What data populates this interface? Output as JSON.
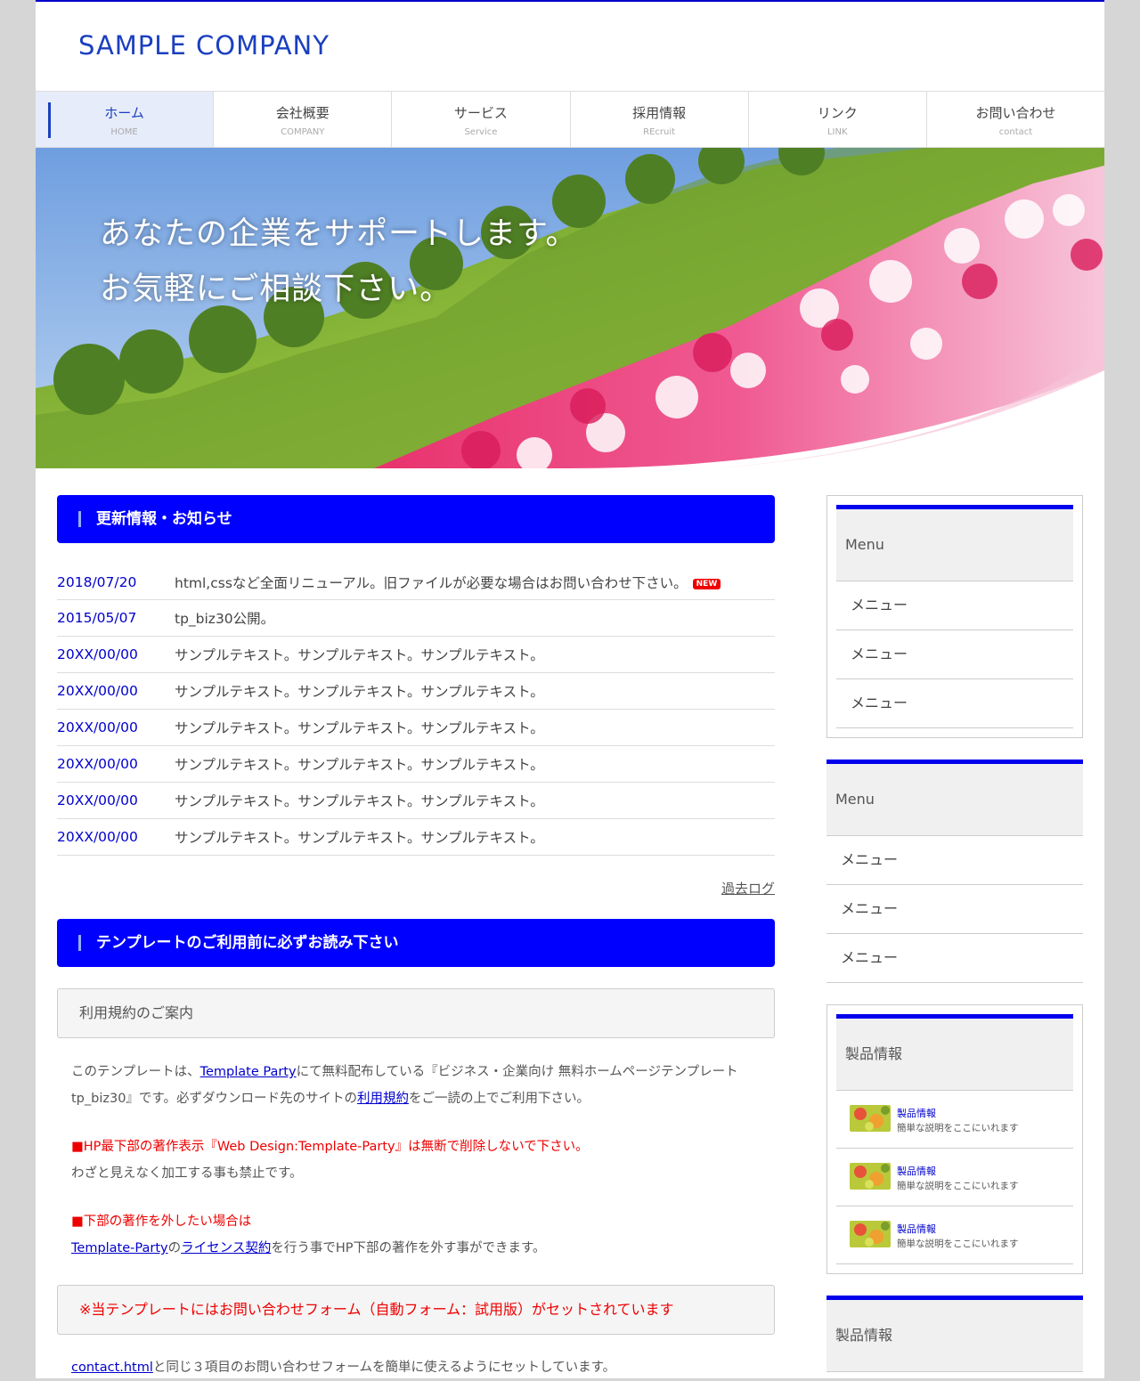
{
  "logo": "SAMPLE COMPANY",
  "nav": [
    {
      "ja": "ホーム",
      "en": "HOME"
    },
    {
      "ja": "会社概要",
      "en": "COMPANY"
    },
    {
      "ja": "サービス",
      "en": "Service"
    },
    {
      "ja": "採用情報",
      "en": "REcruit"
    },
    {
      "ja": "リンク",
      "en": "LINK"
    },
    {
      "ja": "お問い合わせ",
      "en": "contact"
    }
  ],
  "hero": {
    "line1": "あなたの企業をサポートします。",
    "line2": "お気軽にご相談下さい。"
  },
  "news": {
    "heading": "更新情報・お知らせ",
    "badge": "NEW",
    "items": [
      {
        "date": "2018/07/20",
        "text": "html,cssなど全面リニューアル。旧ファイルが必要な場合はお問い合わせ下さい。"
      },
      {
        "date": "2015/05/07",
        "text": "tp_biz30公開。"
      },
      {
        "date": "20XX/00/00",
        "text": "サンプルテキスト。サンプルテキスト。サンプルテキスト。"
      },
      {
        "date": "20XX/00/00",
        "text": "サンプルテキスト。サンプルテキスト。サンプルテキスト。"
      },
      {
        "date": "20XX/00/00",
        "text": "サンプルテキスト。サンプルテキスト。サンプルテキスト。"
      },
      {
        "date": "20XX/00/00",
        "text": "サンプルテキスト。サンプルテキスト。サンプルテキスト。"
      },
      {
        "date": "20XX/00/00",
        "text": "サンプルテキスト。サンプルテキスト。サンプルテキスト。"
      },
      {
        "date": "20XX/00/00",
        "text": "サンプルテキスト。サンプルテキスト。サンプルテキスト。"
      }
    ],
    "past_log": "過去ログ"
  },
  "template": {
    "heading": "テンプレートのご利用前に必ずお読み下さい",
    "box1": "利用規約のご案内",
    "p1_a": "このテンプレートは、",
    "p1_link1": "Template Party",
    "p1_b": "にて無料配布している『ビジネス・企業向け 無料ホームページテンプレート tp_biz30』です。必ずダウンロード先のサイトの",
    "p1_link2": "利用規約",
    "p1_c": "をご一読の上でご利用下さい。",
    "p2_red": "■HP最下部の著作表示『Web Design:Template-Party』は無断で削除しないで下さい。",
    "p2_b": "わざと見えなく加工する事も禁止です。",
    "p3_red": "■下部の著作を外したい場合は",
    "p3_link1": "Template-Party",
    "p3_a": "の",
    "p3_link2": "ライセンス契約",
    "p3_b": "を行う事でHP下部の著作を外す事ができます。",
    "box2": "※当テンプレートにはお問い合わせフォーム（自動フォーム：試用版）がセットされています",
    "p4_link": "contact.html",
    "p4_text": "と同じ３項目のお問い合わせフォームを簡単に使えるようにセットしています。"
  },
  "sidebar": {
    "menu1": {
      "title": "Menu",
      "items": [
        "メニュー",
        "メニュー",
        "メニュー"
      ]
    },
    "menu2": {
      "title": "Menu",
      "items": [
        "メニュー",
        "メニュー",
        "メニュー"
      ]
    },
    "products": {
      "title": "製品情報",
      "items": [
        {
          "title": "製品情報",
          "desc": "簡単な説明をここにいれます"
        },
        {
          "title": "製品情報",
          "desc": "簡単な説明をここにいれます"
        },
        {
          "title": "製品情報",
          "desc": "簡単な説明をここにいれます"
        }
      ]
    },
    "products2": {
      "title": "製品情報"
    }
  },
  "colors": {
    "accent": "#0000ff",
    "link": "#0000cc",
    "logo": "#1a3fbf",
    "notice_red": "#ee0000"
  }
}
